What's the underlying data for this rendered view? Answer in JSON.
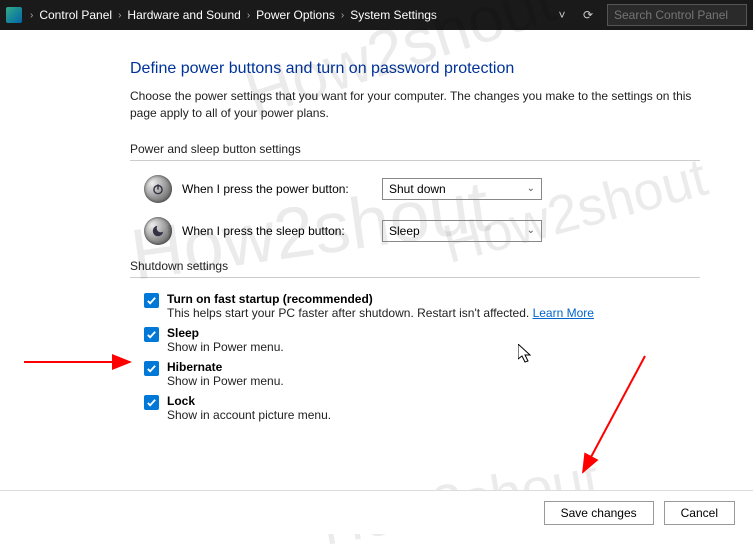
{
  "breadcrumb": {
    "items": [
      "Control Panel",
      "Hardware and Sound",
      "Power Options",
      "System Settings"
    ]
  },
  "search": {
    "placeholder": "Search Control Panel"
  },
  "page": {
    "title": "Define power buttons and turn on password protection",
    "desc": "Choose the power settings that you want for your computer. The changes you make to the settings on this page apply to all of your power plans."
  },
  "section1": {
    "label": "Power and sleep button settings",
    "power_button": {
      "label": "When I press the power button:",
      "value": "Shut down"
    },
    "sleep_button": {
      "label": "When I press the sleep button:",
      "value": "Sleep"
    }
  },
  "section2": {
    "label": "Shutdown settings",
    "fast_startup": {
      "title": "Turn on fast startup (recommended)",
      "sub": "This helps start your PC faster after shutdown. Restart isn't affected. ",
      "learn": "Learn More",
      "checked": true
    },
    "sleep": {
      "title": "Sleep",
      "sub": "Show in Power menu.",
      "checked": true
    },
    "hibernate": {
      "title": "Hibernate",
      "sub": "Show in Power menu.",
      "checked": true
    },
    "lock": {
      "title": "Lock",
      "sub": "Show in account picture menu.",
      "checked": true
    }
  },
  "footer": {
    "save": "Save changes",
    "cancel": "Cancel"
  },
  "watermark": "How2shout"
}
